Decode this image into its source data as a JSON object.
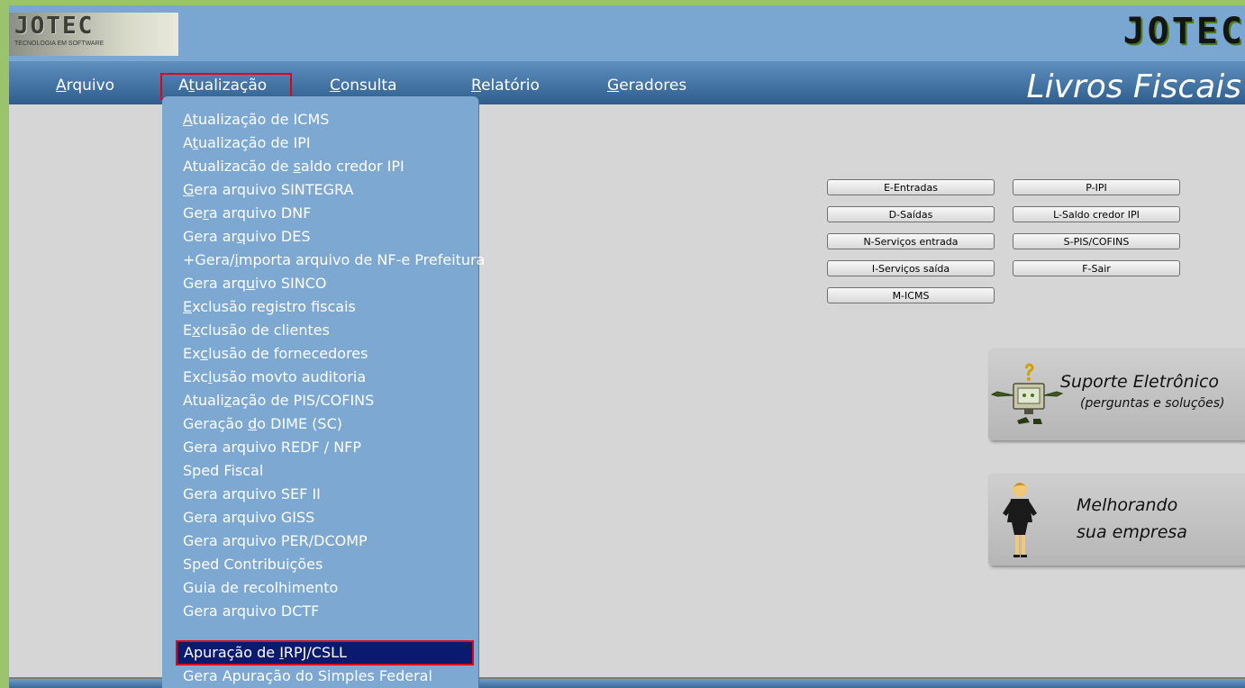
{
  "header": {
    "logo_text": "JOTEC",
    "logo_subtitle": "TECNOLOGIA EM SOFTWARE",
    "brand_right": "JOTEC",
    "app_title": "Livros Fiscais"
  },
  "menu": [
    {
      "pre": "",
      "u": "A",
      "post": "rquivo"
    },
    {
      "pre": "A",
      "u": "t",
      "post": "ualização"
    },
    {
      "pre": "",
      "u": "C",
      "post": "onsulta"
    },
    {
      "pre": "",
      "u": "R",
      "post": "elatório"
    },
    {
      "pre": "",
      "u": "G",
      "post": "eradores"
    }
  ],
  "dropdown": [
    {
      "pre": "",
      "u": "A",
      "post": "tualização de ICMS"
    },
    {
      "pre": "A",
      "u": "t",
      "post": "ualização de IPI"
    },
    {
      "pre": "Atualizacão de ",
      "u": "s",
      "post": "aldo credor IPI"
    },
    {
      "pre": "",
      "u": "G",
      "post": "era arquivo SINTEGRA"
    },
    {
      "pre": "Ge",
      "u": "r",
      "post": "a arquivo DNF"
    },
    {
      "pre": "Gera ar",
      "u": "q",
      "post": "uivo DES"
    },
    {
      "pre": "+Gera/",
      "u": "i",
      "post": "mporta arquivo de NF-e Prefeitura"
    },
    {
      "pre": "Gera arq",
      "u": "u",
      "post": "ivo SINCO"
    },
    {
      "pre": "",
      "u": "E",
      "post": "xclusão registro fiscais"
    },
    {
      "pre": "E",
      "u": "x",
      "post": "clusão de clientes"
    },
    {
      "pre": "Ex",
      "u": "c",
      "post": "lusão de fornecedores"
    },
    {
      "pre": "Exc",
      "u": "l",
      "post": "usão movto auditoria"
    },
    {
      "pre": "Atuali",
      "u": "z",
      "post": "ação de PIS/COFINS"
    },
    {
      "pre": "Geração ",
      "u": "d",
      "post": "o DIME (SC)"
    },
    {
      "pre": "Gera arquivo REDF / NFP",
      "u": "",
      "post": ""
    },
    {
      "pre": "Sped Fiscal",
      "u": "",
      "post": ""
    },
    {
      "pre": "Gera arquivo SEF II",
      "u": "",
      "post": ""
    },
    {
      "pre": "Gera arquivo GISS",
      "u": "",
      "post": ""
    },
    {
      "pre": "Gera arquivo PER/DCOMP",
      "u": "",
      "post": ""
    },
    {
      "pre": "Sped Contribuições",
      "u": "",
      "post": ""
    },
    {
      "pre": "Guia de recolhimento",
      "u": "",
      "post": ""
    },
    {
      "pre": "Gera arquivo DCTF",
      "u": "",
      "post": ""
    },
    {
      "pre": "Apuração de ",
      "u": "I",
      "post": "RPJ/CSLL"
    },
    {
      "pre": "Gera Apuração do Simples Federal",
      "u": "",
      "post": ""
    }
  ],
  "buttons": [
    "E-Entradas",
    "P-IPI",
    "D-Saídas",
    "L-Saldo credor IPI",
    "N-Serviços entrada",
    "S-PIS/COFINS",
    "I-Serviços saída",
    "F-Sair",
    "M-ICMS"
  ],
  "support_panel": {
    "title": "Suporte Eletrônico",
    "subtitle": "(perguntas e soluções)"
  },
  "improve_panel": {
    "line1": "Melhorando",
    "line2": "sua empresa"
  }
}
